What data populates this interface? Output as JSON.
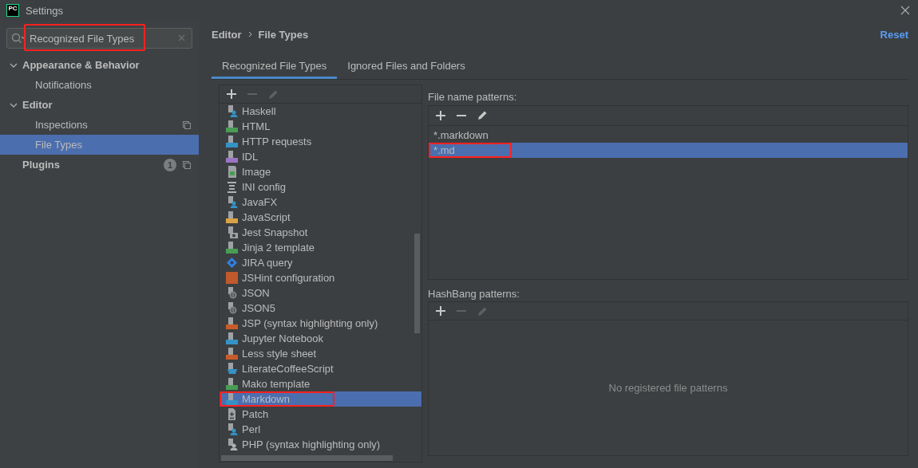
{
  "window": {
    "title": "Settings",
    "logo": "PC"
  },
  "search": {
    "value": "Recognized File Types",
    "highlighted": true
  },
  "sidebar": {
    "items": [
      {
        "label": "Appearance & Behavior",
        "expanded": true,
        "selected": false,
        "children": [
          {
            "label": "Notifications",
            "selected": false
          }
        ]
      },
      {
        "label": "Editor",
        "expanded": true,
        "selected": false,
        "children": [
          {
            "label": "Inspections",
            "selected": false,
            "copy": true
          },
          {
            "label": "File Types",
            "selected": true
          }
        ]
      },
      {
        "label": "Plugins",
        "selected": false,
        "count": "1",
        "copy": true
      }
    ]
  },
  "breadcrumb": [
    "Editor",
    "File Types"
  ],
  "reset": "Reset",
  "tabs": [
    {
      "label": "Recognized File Types",
      "selected": true
    },
    {
      "label": "Ignored Files and Folders",
      "selected": false
    }
  ],
  "file_types": [
    {
      "label": "Haskell",
      "kind": "person",
      "color": "#3592c4",
      "selected": false
    },
    {
      "label": "HTML",
      "kind": "badge",
      "color": "#499c54",
      "selected": false
    },
    {
      "label": "HTTP requests",
      "kind": "badge",
      "color": "#3592c4",
      "selected": false
    },
    {
      "label": "IDL",
      "kind": "badge",
      "color": "#9c74c1",
      "selected": false
    },
    {
      "label": "Image",
      "kind": "image",
      "color": "#499c54",
      "selected": false
    },
    {
      "label": "INI config",
      "kind": "ini",
      "color": "#afb1b3",
      "selected": false
    },
    {
      "label": "JavaFX",
      "kind": "person",
      "color": "#3592c4",
      "selected": false
    },
    {
      "label": "JavaScript",
      "kind": "badge",
      "color": "#d9a343",
      "selected": false
    },
    {
      "label": "Jest Snapshot",
      "kind": "camera",
      "selected": false
    },
    {
      "label": "Jinja 2 template",
      "kind": "badge",
      "color": "#499c54",
      "selected": false
    },
    {
      "label": "JIRA query",
      "kind": "jira",
      "color": "#2f80e7",
      "selected": false
    },
    {
      "label": "JSHint configuration",
      "kind": "block",
      "color": "#c05a2c",
      "selected": false
    },
    {
      "label": "JSON",
      "kind": "json",
      "selected": false
    },
    {
      "label": "JSON5",
      "kind": "json",
      "selected": false
    },
    {
      "label": "JSP (syntax highlighting only)",
      "kind": "badge",
      "color": "#c75c29",
      "selected": false
    },
    {
      "label": "Jupyter Notebook",
      "kind": "badge",
      "color": "#3592c4",
      "selected": false
    },
    {
      "label": "Less style sheet",
      "kind": "badge",
      "color": "#c75c29",
      "selected": false
    },
    {
      "label": "LiterateCoffeeScript",
      "kind": "cup",
      "color": "#3592c4",
      "selected": false
    },
    {
      "label": "Mako template",
      "kind": "badge",
      "color": "#499c54",
      "selected": false
    },
    {
      "label": "Markdown",
      "kind": "badge",
      "color": "#3592c4",
      "selected": true,
      "highlighted": true
    },
    {
      "label": "Patch",
      "kind": "patch",
      "selected": false
    },
    {
      "label": "Perl",
      "kind": "person",
      "color": "#3592c4",
      "selected": false
    },
    {
      "label": "PHP (syntax highlighting only)",
      "kind": "person",
      "color": "#afb1b3",
      "selected": false
    }
  ],
  "file_name_patterns": {
    "label": "File name patterns:",
    "rows": [
      {
        "label": "*.markdown",
        "selected": false
      },
      {
        "label": "*.md",
        "selected": true,
        "highlighted": true
      }
    ]
  },
  "hashbang_patterns": {
    "label": "HashBang patterns:",
    "empty": "No registered file patterns"
  }
}
